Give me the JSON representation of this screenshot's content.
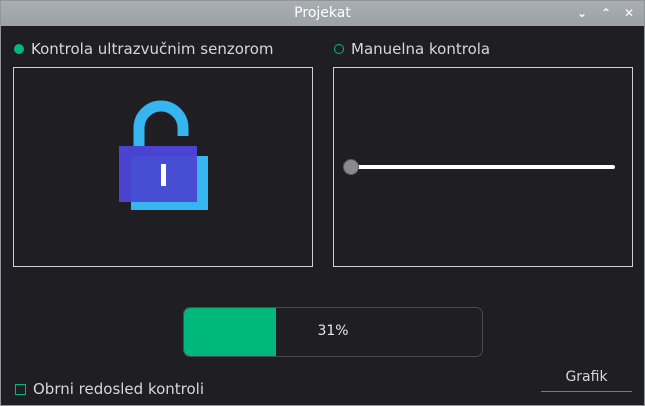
{
  "window": {
    "title": "Projekat",
    "controls": {
      "minimize": "⌄",
      "maximize": "⌃",
      "close": "✕"
    }
  },
  "modes": {
    "ultrasonic_label": "Kontrola ultrazvučnim senzorom",
    "ultrasonic_selected": true,
    "manual_label": "Manuelna kontrola",
    "manual_selected": false
  },
  "left_panel": {
    "icon": "lock-open-icon",
    "colors": {
      "shackle": "#35b6f0",
      "body_back": "#4a43d0",
      "body_front": "#35b6f0",
      "keyhole": "#ffffff"
    }
  },
  "right_panel": {
    "slider_value": 0
  },
  "progress": {
    "value": 0.31,
    "text": "31%"
  },
  "options": {
    "reverse_label": "Obrni redosled kontroli",
    "reverse_checked": false
  },
  "graph_button": {
    "label": "Grafik"
  },
  "colors": {
    "accent": "#00b87a",
    "background": "#1f1e22",
    "titlebar": "#a3a8ad"
  }
}
